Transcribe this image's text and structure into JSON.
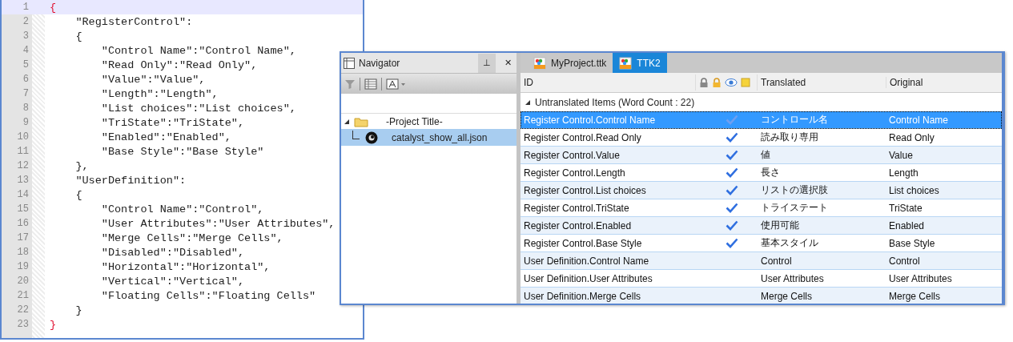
{
  "editor": {
    "lines": [
      {
        "number": "1",
        "text": "{",
        "kind": "brace",
        "current": true
      },
      {
        "number": "2",
        "text": "    \"RegisterControl\":",
        "kind": "code",
        "current": false
      },
      {
        "number": "3",
        "text": "    {",
        "kind": "code",
        "current": false
      },
      {
        "number": "4",
        "text": "        \"Control Name\":\"Control Name\",",
        "kind": "code",
        "current": false
      },
      {
        "number": "5",
        "text": "        \"Read Only\":\"Read Only\",",
        "kind": "code",
        "current": false
      },
      {
        "number": "6",
        "text": "        \"Value\":\"Value\",",
        "kind": "code",
        "current": false
      },
      {
        "number": "7",
        "text": "        \"Length\":\"Length\",",
        "kind": "code",
        "current": false
      },
      {
        "number": "8",
        "text": "        \"List choices\":\"List choices\",",
        "kind": "code",
        "current": false
      },
      {
        "number": "9",
        "text": "        \"TriState\":\"TriState\",",
        "kind": "code",
        "current": false
      },
      {
        "number": "10",
        "text": "        \"Enabled\":\"Enabled\",",
        "kind": "code",
        "current": false
      },
      {
        "number": "11",
        "text": "        \"Base Style\":\"Base Style\"",
        "kind": "code",
        "current": false
      },
      {
        "number": "12",
        "text": "    },",
        "kind": "code",
        "current": false
      },
      {
        "number": "13",
        "text": "    \"UserDefinition\":",
        "kind": "code",
        "current": false
      },
      {
        "number": "14",
        "text": "    {",
        "kind": "code",
        "current": false
      },
      {
        "number": "15",
        "text": "        \"Control Name\":\"Control\",",
        "kind": "code",
        "current": false
      },
      {
        "number": "16",
        "text": "        \"User Attributes\":\"User Attributes\",",
        "kind": "code",
        "current": false
      },
      {
        "number": "17",
        "text": "        \"Merge Cells\":\"Merge Cells\",",
        "kind": "code",
        "current": false
      },
      {
        "number": "18",
        "text": "        \"Disabled\":\"Disabled\",",
        "kind": "code",
        "current": false
      },
      {
        "number": "19",
        "text": "        \"Horizontal\":\"Horizontal\",",
        "kind": "code",
        "current": false
      },
      {
        "number": "20",
        "text": "        \"Vertical\":\"Vertical\",",
        "kind": "code",
        "current": false
      },
      {
        "number": "21",
        "text": "        \"Floating Cells\":\"Floating Cells\"",
        "kind": "code",
        "current": false
      },
      {
        "number": "22",
        "text": "    }",
        "kind": "code",
        "current": false
      },
      {
        "number": "23",
        "text": "}",
        "kind": "brace",
        "current": false
      }
    ]
  },
  "navigator": {
    "title": "Navigator",
    "pin": "⊥",
    "close": "✕",
    "tree": [
      {
        "label": "-Project Title-",
        "expanded": true,
        "selected": false,
        "children": [
          {
            "label": "catalyst_show_all.json",
            "selected": true
          }
        ]
      }
    ]
  },
  "tabs": [
    {
      "label": "MyProject.ttk",
      "selected": false
    },
    {
      "label": "TTK2",
      "selected": true
    }
  ],
  "table": {
    "columns": {
      "id": "ID",
      "translated": "Translated",
      "original": "Original"
    },
    "group": {
      "label": "Untranslated Items (Word Count : 22)",
      "expanded": true
    },
    "rows": [
      {
        "id": "Register Control.Control Name",
        "checked": true,
        "translated": "コントロール名",
        "original": "Control Name",
        "selected": true
      },
      {
        "id": "Register Control.Read Only",
        "checked": true,
        "translated": "読み取り専用",
        "original": "Read Only",
        "selected": false
      },
      {
        "id": "Register Control.Value",
        "checked": true,
        "translated": "値",
        "original": "Value",
        "selected": false
      },
      {
        "id": "Register Control.Length",
        "checked": true,
        "translated": "長さ",
        "original": "Length",
        "selected": false
      },
      {
        "id": "Register Control.List choices",
        "checked": true,
        "translated": "リストの選択肢",
        "original": "List choices",
        "selected": false
      },
      {
        "id": "Register Control.TriState",
        "checked": true,
        "translated": "トライステート",
        "original": "TriState",
        "selected": false
      },
      {
        "id": "Register Control.Enabled",
        "checked": true,
        "translated": "使用可能",
        "original": "Enabled",
        "selected": false
      },
      {
        "id": "Register Control.Base Style",
        "checked": true,
        "translated": "基本スタイル",
        "original": "Base Style",
        "selected": false
      },
      {
        "id": "User Definition.Control Name",
        "checked": false,
        "translated": "Control",
        "original": "Control",
        "selected": false
      },
      {
        "id": "User Definition.User Attributes",
        "checked": false,
        "translated": "User Attributes",
        "original": "User Attributes",
        "selected": false
      },
      {
        "id": "User Definition.Merge Cells",
        "checked": false,
        "translated": "Merge Cells",
        "original": "Merge Cells",
        "selected": false
      }
    ]
  }
}
